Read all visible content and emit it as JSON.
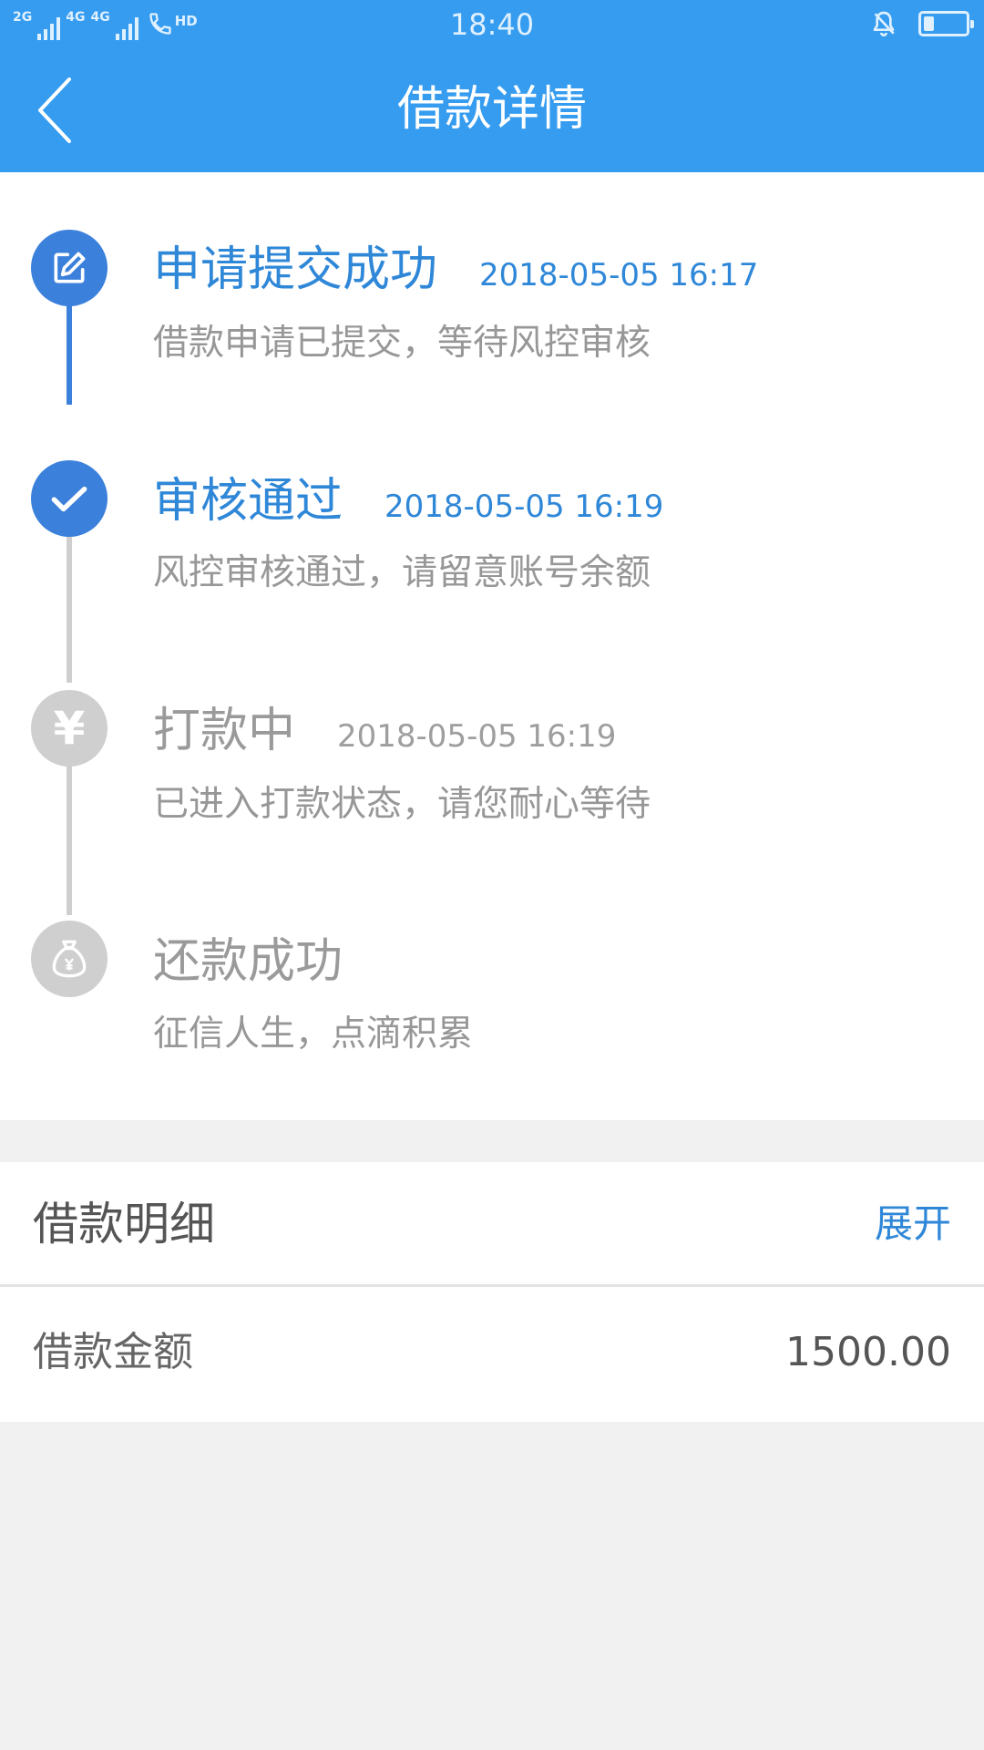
{
  "status_bar": {
    "network_1": "2G",
    "network_2": "4G",
    "network_3": "4G",
    "hd": "HD",
    "time": "18:40",
    "battery_level": 0.25
  },
  "header": {
    "title": "借款详情",
    "back_icon": "chevron-left-icon"
  },
  "timeline": {
    "steps": [
      {
        "title": "申请提交成功",
        "time": "2018-05-05 16:17",
        "description": "借款申请已提交，等待风控审核",
        "icon": "edit-icon",
        "active": true
      },
      {
        "title": "审核通过",
        "time": "2018-05-05 16:19",
        "description": "风控审核通过，请留意账号余额",
        "icon": "check-icon",
        "active": true
      },
      {
        "title": "打款中",
        "time": "2018-05-05 16:19",
        "description": "已进入打款状态，请您耐心等待",
        "icon": "yuan-icon",
        "active": false
      },
      {
        "title": "还款成功",
        "time": "",
        "description": "征信人生，点滴积累",
        "icon": "money-bag-icon",
        "active": false
      }
    ],
    "yuan_symbol": "¥"
  },
  "details": {
    "title": "借款明细",
    "expand_label": "展开",
    "amount_label": "借款金额",
    "amount_value": "1500.00"
  },
  "colors": {
    "header_blue": "#359cf0",
    "active_blue": "#3b80db",
    "text_blue": "#2f87d8",
    "inactive_gray": "#cfcfcf",
    "background": "#f1f1f1"
  }
}
